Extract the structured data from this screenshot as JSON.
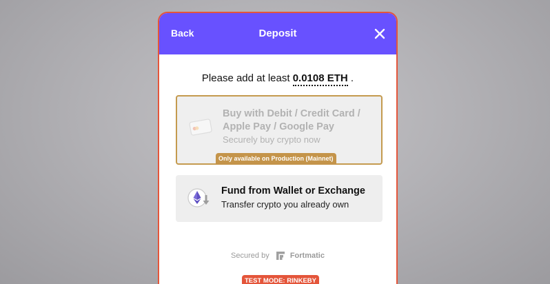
{
  "header": {
    "back_label": "Back",
    "title": "Deposit",
    "close_icon": "close-icon"
  },
  "prompt": {
    "text": "Please add at least ",
    "amount": "0.0108 ETH",
    "suffix": " ."
  },
  "options": [
    {
      "title": "Buy with Debit / Credit Card / Apple Pay / Google Pay",
      "subtitle": "Securely buy crypto now",
      "badge": "Only available on Production (Mainnet)",
      "icon": "credit-card-icon",
      "disabled": true
    },
    {
      "title": "Fund from Wallet or Exchange",
      "subtitle": "Transfer crypto you already own",
      "icon": "eth-transfer-icon",
      "disabled": false
    }
  ],
  "footer": {
    "secured_by": "Secured by",
    "brand": "Fortmatic",
    "test_mode": "TEST MODE: RINKEBY"
  },
  "colors": {
    "header": "#6851ff",
    "modal_border": "#e4553a",
    "badge_gold": "#c4944a",
    "test_badge": "#e4553a"
  }
}
